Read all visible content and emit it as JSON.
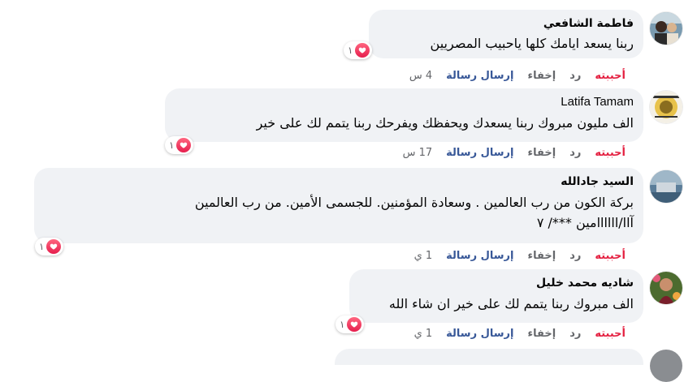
{
  "comments": [
    {
      "name": "فاطمة الشافعي",
      "text": [
        "ربنا يسعد ايامك كلها ياحبيب المصريين"
      ],
      "reaction_count": "١",
      "actions": {
        "like": "أحببته",
        "reply": "رد",
        "hide": "إخفاء",
        "send": "إرسال رسالة",
        "time": "4 س"
      },
      "avatar_icon": "profile-photo"
    },
    {
      "name": "Latifa Tamam",
      "text": [
        "الف مليون مبروك ربنا يسعدك ويحفظك ويفرحك ربنا يتمم لك على خير"
      ],
      "reaction_count": "١",
      "actions": {
        "like": "أحببته",
        "reply": "رد",
        "hide": "إخفاء",
        "send": "إرسال رسالة",
        "time": "17 س"
      },
      "avatar_icon": "profile-photo"
    },
    {
      "name": "السيد جادالله",
      "text": [
        "بركة الكون من رب العالمين . وسعادة المؤمنين. للجسمى الأمين. من رب العالمين",
        "آاا/اااااامين ***/ ٧"
      ],
      "reaction_count": "١",
      "actions": {
        "like": "أحببته",
        "reply": "رد",
        "hide": "إخفاء",
        "send": "إرسال رسالة",
        "time": "1 ي"
      },
      "avatar_icon": "profile-photo"
    },
    {
      "name": "شاديه محمد خليل",
      "text": [
        "الف مبروك ربنا يتمم لك على خير ان شاء الله"
      ],
      "reaction_count": "١",
      "actions": {
        "like": "أحببته",
        "reply": "رد",
        "hide": "إخفاء",
        "send": "إرسال رسالة",
        "time": "1 ي"
      },
      "avatar_icon": "profile-photo"
    }
  ],
  "colors": {
    "bubble": "#f0f2f5",
    "like": "#e41e3f",
    "send": "#385898",
    "muted": "#65676b",
    "heart": "#f33e58"
  }
}
